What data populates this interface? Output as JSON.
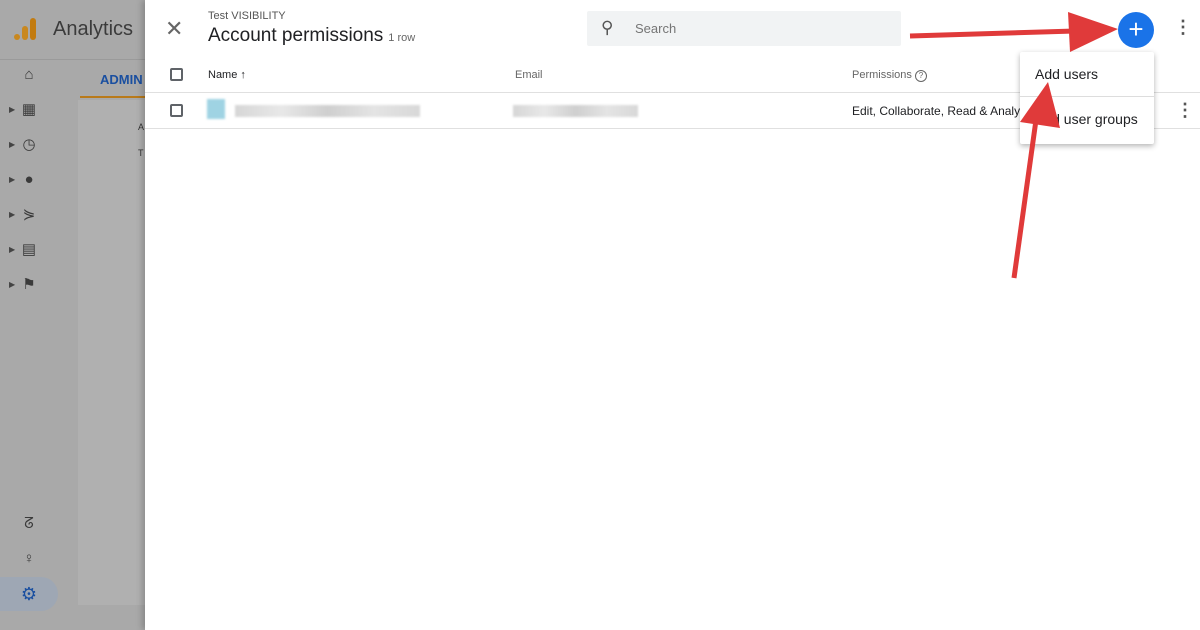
{
  "app": {
    "name": "Analytics",
    "admin_tab": "ADMIN",
    "content_letters": [
      "A",
      "T"
    ]
  },
  "panel": {
    "account_name": "Test VISIBILITY",
    "title": "Account permissions",
    "row_count": "1 row"
  },
  "search": {
    "placeholder": "Search",
    "value": ""
  },
  "table": {
    "columns": {
      "name": "Name",
      "email": "Email",
      "permissions": "Permissions"
    },
    "rows": [
      {
        "permissions": "Edit, Collaborate, Read & Analyze"
      }
    ]
  },
  "menu": {
    "items": [
      "Add users",
      "Add user groups"
    ]
  },
  "colors": {
    "accent": "#1a73e8",
    "annotation_arrows": "#e03a3a"
  }
}
